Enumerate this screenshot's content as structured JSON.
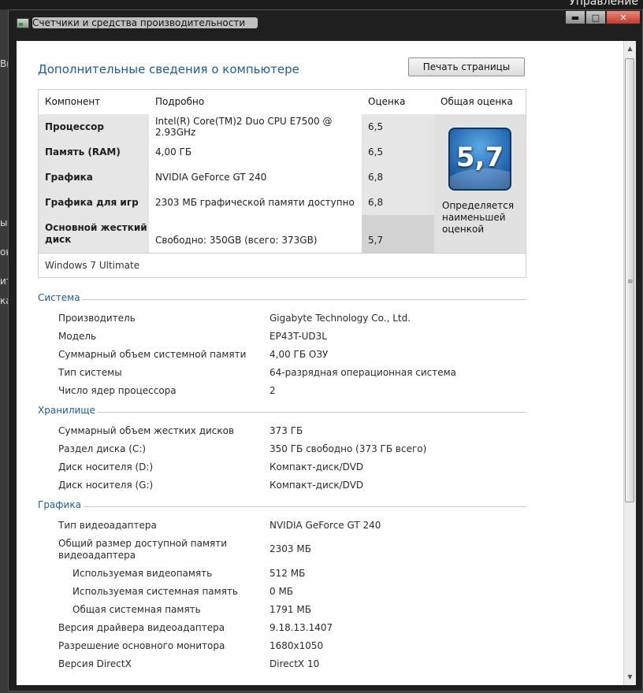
{
  "background": {
    "top_right_text": "Управление",
    "left_fragments": [
      "Вы",
      "ых",
      "ов",
      "ить",
      "ка"
    ]
  },
  "window": {
    "title": "Счетчики и средства производительности",
    "controls": {
      "minimize": "▬",
      "maximize": "□",
      "close": "✕"
    }
  },
  "page": {
    "heading": "Дополнительные сведения о компьютере",
    "print_button": "Печать страницы"
  },
  "rating": {
    "headers": {
      "component": "Компонент",
      "details": "Подробно",
      "score": "Оценка",
      "overall": "Общая оценка"
    },
    "rows": [
      {
        "component": "Процессор",
        "details": "Intel(R) Core(TM)2 Duo CPU E7500 @ 2.93GHz",
        "score": "6,5"
      },
      {
        "component": "Память (RAM)",
        "details": "4,00 ГБ",
        "score": "6,5"
      },
      {
        "component": "Графика",
        "details": "NVIDIA GeForce GT 240",
        "score": "6,8"
      },
      {
        "component": "Графика для игр",
        "details": "2303 МБ графической памяти доступно",
        "score": "6,8"
      },
      {
        "component": "Основной жесткий диск",
        "details": "Свободно: 350GB (всего: 373GB)",
        "score": "5,7"
      }
    ],
    "overall_score": "5,7",
    "overall_note": "Определяется наименьшей оценкой",
    "os": "Windows 7 Ultimate"
  },
  "sections": {
    "system": {
      "title": "Система",
      "items": [
        {
          "name": "Производитель",
          "value": "Gigabyte Technology Co., Ltd."
        },
        {
          "name": "Модель",
          "value": "EP43T-UD3L"
        },
        {
          "name": "Суммарный объем системной памяти",
          "value": "4,00 ГБ ОЗУ"
        },
        {
          "name": "Тип системы",
          "value": "64-разрядная операционная система"
        },
        {
          "name": "Число ядер процессора",
          "value": "2"
        }
      ]
    },
    "storage": {
      "title": "Хранилище",
      "items": [
        {
          "name": "Суммарный объем жестких дисков",
          "value": "373 ГБ"
        },
        {
          "name": "Раздел диска (C:)",
          "value": "350 ГБ свободно (373 ГБ всего)"
        },
        {
          "name": "Диск носителя (D:)",
          "value": "Компакт-диск/DVD"
        },
        {
          "name": "Диск носителя (G:)",
          "value": "Компакт-диск/DVD"
        }
      ]
    },
    "graphics": {
      "title": "Графика",
      "items": [
        {
          "name": "Тип видеоадаптера",
          "value": "NVIDIA GeForce GT 240"
        },
        {
          "name": "Общий размер доступной памяти видеоадаптера",
          "value": "2303 МБ"
        },
        {
          "name": "Используемая видеопамять",
          "value": "512 МБ"
        },
        {
          "name": "Используемая системная память",
          "value": "0 МБ"
        },
        {
          "name": "Общая системная память",
          "value": "1791 МБ"
        },
        {
          "name": "Версия драйвера видеоадаптера",
          "value": "9.18.13.1407"
        },
        {
          "name": "Разрешение основного монитора",
          "value": "1680x1050"
        },
        {
          "name": "Версия DirectX",
          "value": "DirectX 10"
        }
      ]
    }
  }
}
